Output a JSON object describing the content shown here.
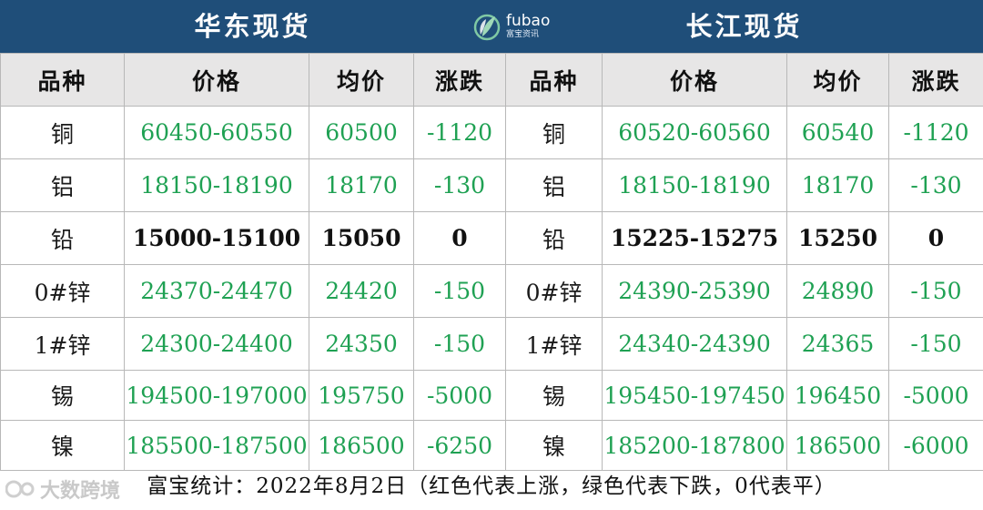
{
  "header": {
    "east_title": "华东现货",
    "yangtze_title": "长江现货",
    "logo_name": "fubao",
    "logo_sub": "富宝资讯"
  },
  "columns": [
    "品种",
    "价格",
    "均价",
    "涨跌",
    "品种",
    "价格",
    "均价",
    "涨跌"
  ],
  "rows": [
    {
      "east": {
        "name": "铜",
        "price": "60450-60550",
        "avg": "60500",
        "change": "-1120"
      },
      "yangtze": {
        "name": "铜",
        "price": "60520-60560",
        "avg": "60540",
        "change": "-1120"
      },
      "trend": "down"
    },
    {
      "east": {
        "name": "铝",
        "price": "18150-18190",
        "avg": "18170",
        "change": "-130"
      },
      "yangtze": {
        "name": "铝",
        "price": "18150-18190",
        "avg": "18170",
        "change": "-130"
      },
      "trend": "down"
    },
    {
      "east": {
        "name": "铅",
        "price": "15000-15100",
        "avg": "15050",
        "change": "0"
      },
      "yangtze": {
        "name": "铅",
        "price": "15225-15275",
        "avg": "15250",
        "change": "0"
      },
      "trend": "flat"
    },
    {
      "east": {
        "name": "0#锌",
        "price": "24370-24470",
        "avg": "24420",
        "change": "-150"
      },
      "yangtze": {
        "name": "0#锌",
        "price": "24390-25390",
        "avg": "24890",
        "change": "-150"
      },
      "trend": "down"
    },
    {
      "east": {
        "name": "1#锌",
        "price": "24300-24400",
        "avg": "24350",
        "change": "-150"
      },
      "yangtze": {
        "name": "1#锌",
        "price": "24340-24390",
        "avg": "24365",
        "change": "-150"
      },
      "trend": "down"
    },
    {
      "east": {
        "name": "锡",
        "price": "194500-197000",
        "avg": "195750",
        "change": "-5000"
      },
      "yangtze": {
        "name": "锡",
        "price": "195450-197450",
        "avg": "196450",
        "change": "-5000"
      },
      "trend": "down"
    },
    {
      "east": {
        "name": "镍",
        "price": "185500-187500",
        "avg": "186500",
        "change": "-6250"
      },
      "yangtze": {
        "name": "镍",
        "price": "185200-187800",
        "avg": "186500",
        "change": "-6000"
      },
      "trend": "down"
    }
  ],
  "footer": "富宝统计：2022年8月2日（红色代表上涨，绿色代表下跌，0代表平）",
  "watermark": "大数跨境",
  "colors": {
    "header_bg": "#1f4e79",
    "down": "#1fa153",
    "flat": "#111111",
    "column_header_bg": "#e7e6e6"
  }
}
